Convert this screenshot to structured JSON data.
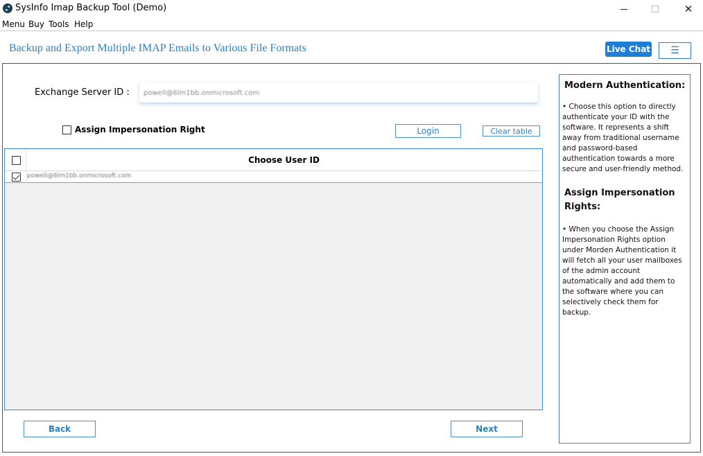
{
  "window": {
    "title": "SysInfo Imap Backup Tool (Demo)",
    "close_glyph": "✕"
  },
  "menu": [
    "Menu",
    "Buy",
    "Tools",
    "Help"
  ],
  "header": {
    "title": "Backup and Export Multiple IMAP Emails to Various File Formats",
    "live_chat_label": "Live Chat",
    "hamburger_glyph": "☰"
  },
  "form": {
    "server_label": "Exchange Server ID :",
    "server_value": "powell@6lm1bb.onmicrosoft.com",
    "impersonation_label": "Assign Impersonation Right",
    "impersonation_checked": false,
    "login_label": "Login",
    "clear_table_label": "Clear table"
  },
  "table": {
    "column_header": "Choose User ID",
    "rows": [
      {
        "email": "powell@6lm1bb.onmicrosoft.com",
        "checked": true
      }
    ]
  },
  "footer": {
    "back_label": "Back",
    "next_label": "Next"
  },
  "info": {
    "heading1": "Modern Authentication:",
    "text1": "•  Choose this option to directly authenticate your ID with the software. It represents a shift away from traditional username and password-based authentication towards a more secure and user-friendly method.",
    "heading2": "Assign Impersonation Rights:",
    "text2": "•  When you choose the Assign Impersonation Rights option under Morden Authentication it will fetch all your user mailboxes of the admin account automatically and add them to the software where you can selectively check them for backup."
  },
  "colors": {
    "accent": "#2a7fc4",
    "live_chat_bg": "#1e7fd6",
    "panel_border": "#3b88c9",
    "table_bg": "#f0f0f0"
  }
}
